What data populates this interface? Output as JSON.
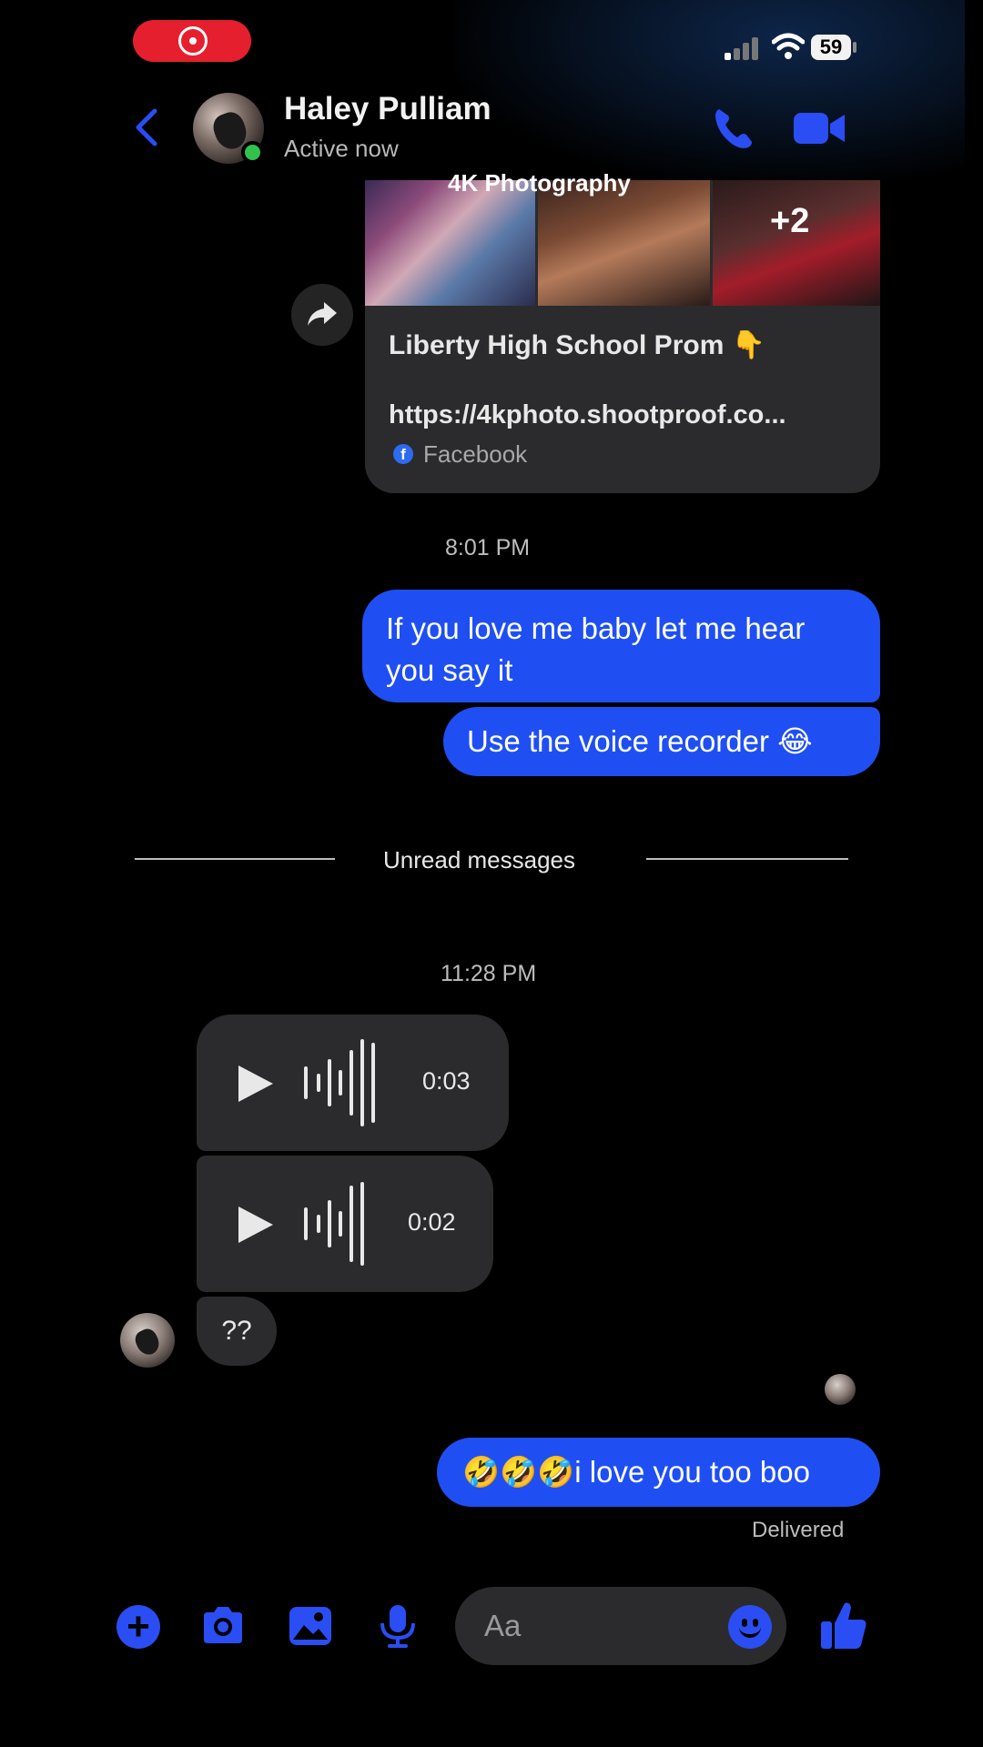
{
  "status_bar": {
    "battery": "59"
  },
  "header": {
    "contact_name": "Haley Pulliam",
    "contact_status": "Active now"
  },
  "shared_link": {
    "photo_caption": "4K Photography",
    "extra_photos": "+2",
    "title": "Liberty High School Prom 👇",
    "url": "https://4kphoto.shootproof.co...",
    "source": "Facebook",
    "source_icon_letter": "f"
  },
  "conversation": {
    "timestamp_1": "8:01 PM",
    "sent_message_1": "If you love me baby let me hear you say it",
    "sent_message_2": "Use the voice recorder 😂",
    "unread_divider": "Unread messages",
    "timestamp_2": "11:28 PM",
    "voice_message_1_duration": "0:03",
    "voice_message_2_duration": "0:02",
    "received_text": "??",
    "sent_message_3": "🤣🤣🤣i love you too boo",
    "delivery_status": "Delivered"
  },
  "composer": {
    "placeholder": "Aa",
    "icons": [
      "plus-icon",
      "camera-icon",
      "gallery-icon",
      "microphone-icon",
      "emoji-icon",
      "thumbs-up-icon"
    ]
  },
  "colors": {
    "accent_blue": "#1f4ff2",
    "icon_blue": "#2a4ef3",
    "bubble_gray": "#2b2b2d",
    "online_green": "#31c24d",
    "record_red": "#e51f2e"
  }
}
